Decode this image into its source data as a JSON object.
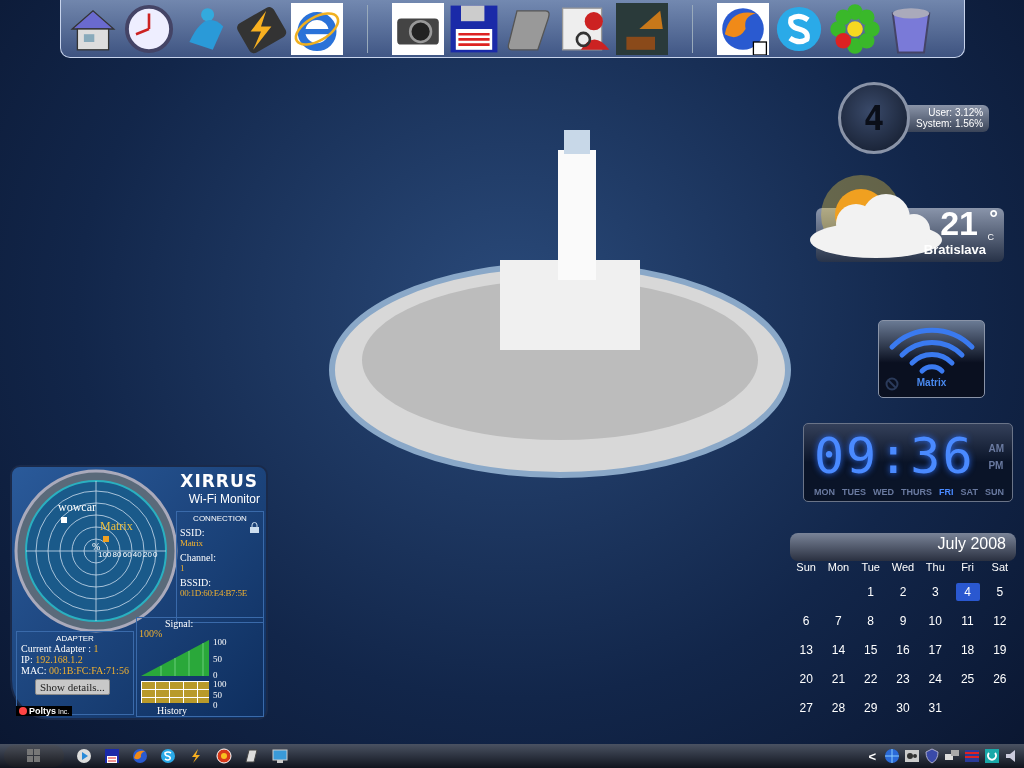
{
  "cpu_meter": {
    "display": "4",
    "user": "User: 3.12%",
    "system": "System: 1.56%"
  },
  "weather": {
    "temperature": "21",
    "degree": "°",
    "unit": "C",
    "city": "Bratislava"
  },
  "wifi_gadget": {
    "network": "Matrix"
  },
  "clock": {
    "time": "09:36",
    "days": [
      {
        "label": "MON",
        "selected": false
      },
      {
        "label": "TUES",
        "selected": false
      },
      {
        "label": "WED",
        "selected": false
      },
      {
        "label": "THURS",
        "selected": false
      },
      {
        "label": "FRI",
        "selected": true
      },
      {
        "label": "SAT",
        "selected": false
      },
      {
        "label": "SUN",
        "selected": false
      }
    ],
    "meridiem": [
      {
        "label": "AM",
        "selected": false
      },
      {
        "label": "PM",
        "selected": false
      }
    ]
  },
  "calendar": {
    "title": "July 2008",
    "weekdays": [
      "Sun",
      "Mon",
      "Tue",
      "Wed",
      "Thu",
      "Fri",
      "Sat"
    ],
    "weeks": [
      [
        {
          "kind": "blank"
        },
        {
          "kind": "blank"
        },
        {
          "kind": "day",
          "day": "1",
          "selected": false
        },
        {
          "day": "2",
          "selected": false
        },
        {
          "day": "3",
          "selected": false
        },
        {
          "day": "4",
          "selected": true
        },
        {
          "day": "5",
          "selected": false
        }
      ],
      [
        {
          "day": "6",
          "selected": false
        },
        {
          "day": "7",
          "selected": false
        },
        {
          "day": "8",
          "selected": false
        },
        {
          "day": "9",
          "selected": false
        },
        {
          "day": "10",
          "selected": false
        },
        {
          "day": "11",
          "selected": false
        },
        {
          "day": "12",
          "selected": false
        }
      ],
      [
        {
          "day": "13",
          "selected": false
        },
        {
          "day": "14",
          "selected": false
        },
        {
          "day": "15",
          "selected": false
        },
        {
          "day": "16",
          "selected": false
        },
        {
          "day": "17",
          "selected": false
        },
        {
          "day": "18",
          "selected": false
        },
        {
          "day": "19",
          "selected": false
        }
      ],
      [
        {
          "day": "20",
          "selected": false
        },
        {
          "day": "21",
          "selected": false
        },
        {
          "day": "22",
          "selected": false
        },
        {
          "day": "23",
          "selected": false
        },
        {
          "day": "24",
          "selected": false
        },
        {
          "day": "25",
          "selected": false
        },
        {
          "day": "26",
          "selected": false
        }
      ],
      [
        {
          "day": "27",
          "selected": false
        },
        {
          "day": "28",
          "selected": false
        },
        {
          "day": "29",
          "selected": false
        },
        {
          "day": "30",
          "selected": false
        },
        {
          "kind": "day",
          "day": "31",
          "selected": false
        },
        {
          "kind": "blank"
        },
        {
          "kind": "blank"
        }
      ]
    ]
  },
  "wifi_monitor": {
    "brand": "XIRRUS",
    "subtitle": "Wi-Fi Monitor",
    "radar": {
      "unit": "%",
      "scale": [
        "100",
        "80",
        "60",
        "40",
        "20",
        "0"
      ],
      "networks": [
        {
          "name": "wowcar",
          "color": "#ffffff"
        },
        {
          "name": "Matrix",
          "color": "#f0a020"
        }
      ]
    },
    "connection": {
      "heading": "CONNECTION",
      "fields": [
        {
          "label": "SSID:",
          "value": "Matrix"
        },
        {
          "label": "Channel:",
          "value": "1"
        },
        {
          "label": "BSSID:",
          "value": "00:1D:60:E4:B7:5E"
        }
      ]
    },
    "adapter": {
      "heading": "ADAPTER",
      "fields": [
        {
          "label": "Current Adapter :",
          "value": "1"
        },
        {
          "label": "IP:",
          "value": "192.168.1.2"
        },
        {
          "label": "MAC:",
          "value": "00:1B:FC:FA:71:56"
        }
      ],
      "button": "Show details..."
    },
    "signal": {
      "label": "Signal:",
      "reading": "100%",
      "ticks": [
        "100",
        "50",
        "0"
      ]
    },
    "history": {
      "label": "History",
      "ticks": [
        "100",
        "50",
        "0"
      ]
    },
    "vendor": {
      "name": "Poltys",
      "suffix": "Inc."
    }
  },
  "taskbar": {
    "tray_chevron": "<"
  }
}
